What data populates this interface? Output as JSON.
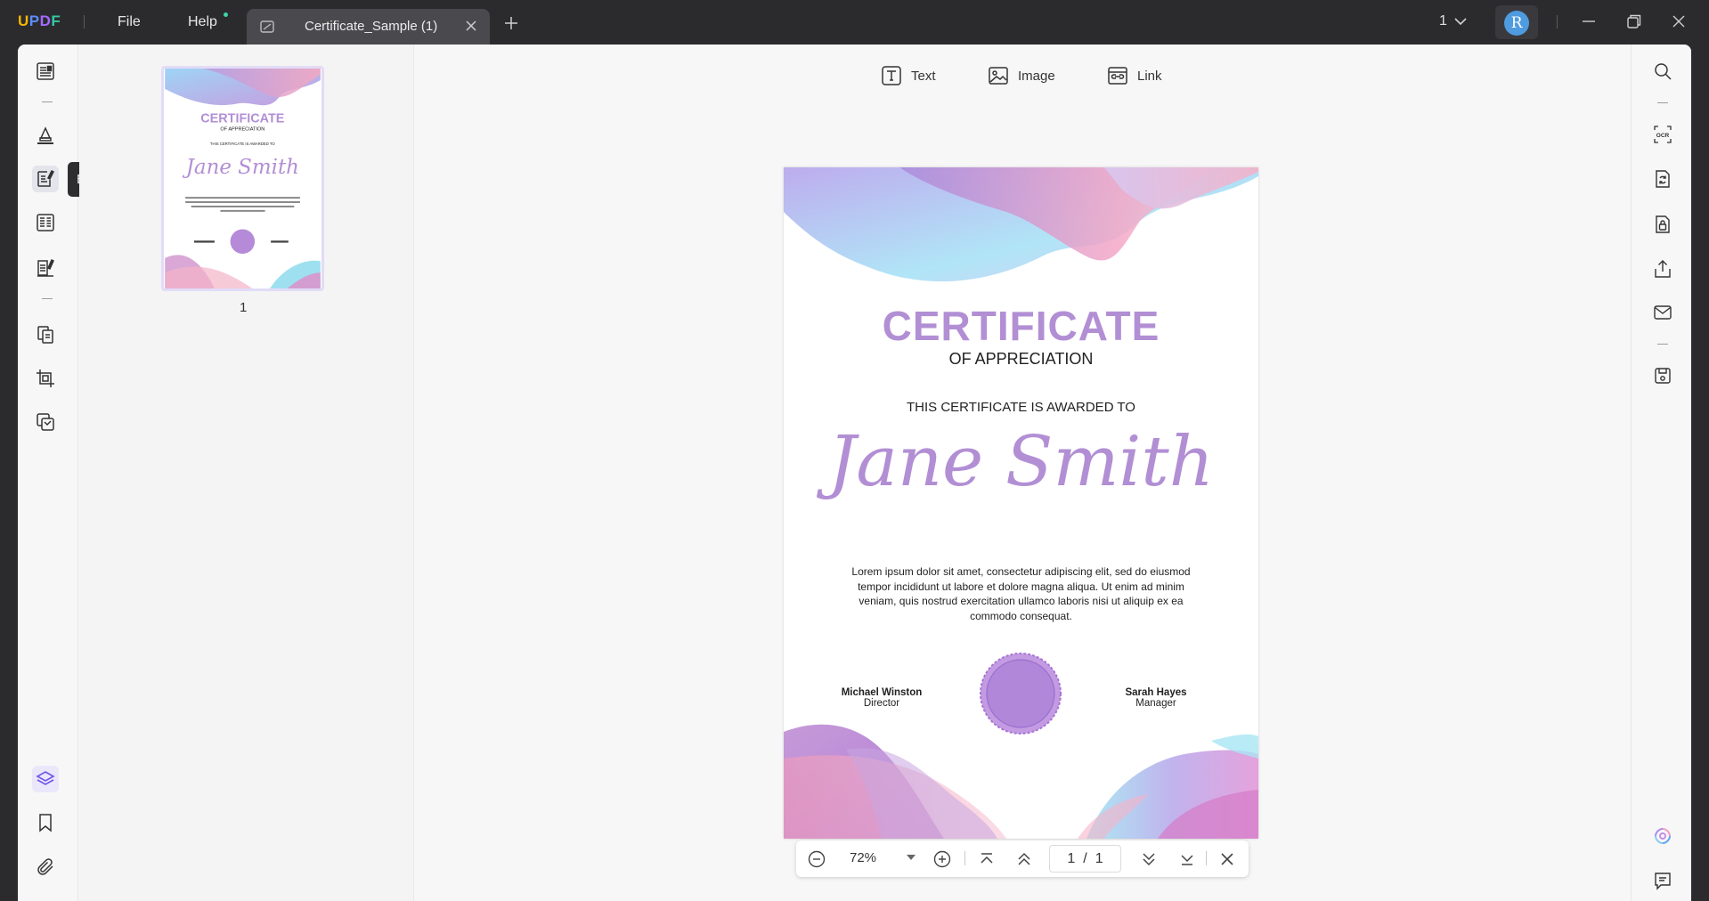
{
  "app": {
    "logo_letters": [
      "U",
      "P",
      "D",
      "F"
    ],
    "logo_colors": [
      "#f7b500",
      "#5b8cff",
      "#a36bff",
      "#33c9a4"
    ]
  },
  "menu": {
    "file_label": "File",
    "help_label": "Help"
  },
  "tab": {
    "title": "Certificate_Sample (1)"
  },
  "titlebar": {
    "page_indicator": "1",
    "avatar_initial": "R"
  },
  "left_rail": {
    "tooltip": "Edit PDF",
    "active_item": "edit-pdf"
  },
  "thumbnails": {
    "items": [
      {
        "label": "1"
      }
    ]
  },
  "edit_toolbar": {
    "text_label": "Text",
    "image_label": "Image",
    "link_label": "Link"
  },
  "certificate": {
    "title": "CERTIFICATE",
    "subtitle": "OF APPRECIATION",
    "awarded_to": "THIS CERTIFICATE IS AWARDED TO",
    "recipient": "Jane Smith",
    "body": "Lorem ipsum dolor sit amet, consectetur adipiscing elit, sed do eiusmod tempor incididunt ut labore et dolore magna aliqua. Ut enim ad minim veniam, quis nostrud exercitation ullamco laboris nisi ut aliquip ex ea commodo consequat.",
    "signer_left_name": "Michael Winston",
    "signer_left_role": "Director",
    "signer_right_name": "Sarah Hayes",
    "signer_right_role": "Manager",
    "accent_color": "#b28fd4"
  },
  "page_nav": {
    "zoom": "72%",
    "current_page": "1",
    "separator": "/",
    "total_pages": "1"
  }
}
